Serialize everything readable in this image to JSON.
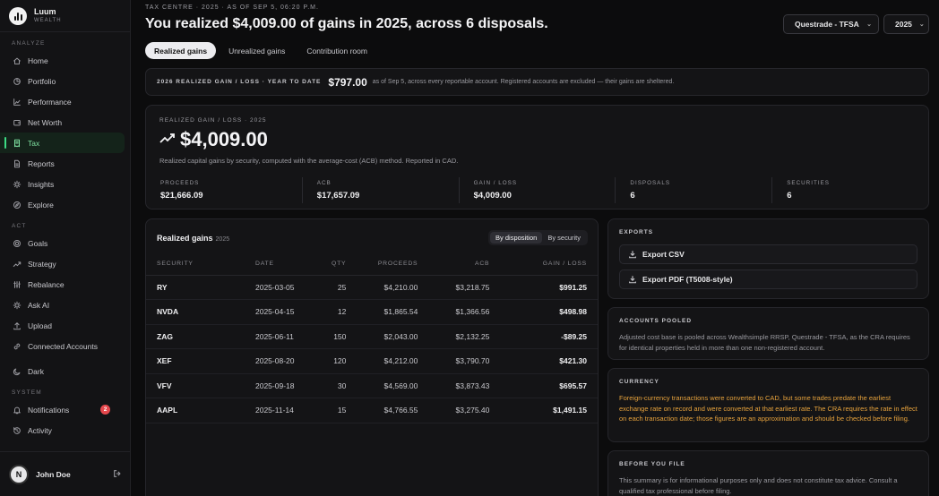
{
  "brand": {
    "name": "Luum",
    "sub": "WEALTH"
  },
  "sidebar": {
    "sections": [
      {
        "title": "ANALYZE",
        "items": [
          {
            "label": "Home",
            "icon": "home-icon"
          },
          {
            "label": "Portfolio",
            "icon": "pie-chart-icon"
          },
          {
            "label": "Performance",
            "icon": "line-chart-icon"
          },
          {
            "label": "Net Worth",
            "icon": "wallet-icon"
          },
          {
            "label": "Tax",
            "icon": "receipt-icon",
            "active": true
          },
          {
            "label": "Reports",
            "icon": "document-icon"
          },
          {
            "label": "Insights",
            "icon": "sparkle-icon"
          },
          {
            "label": "Explore",
            "icon": "compass-icon"
          }
        ]
      },
      {
        "title": "ACT",
        "items": [
          {
            "label": "Goals",
            "icon": "target-icon"
          },
          {
            "label": "Strategy",
            "icon": "trend-icon"
          },
          {
            "label": "Rebalance",
            "icon": "sliders-icon"
          },
          {
            "label": "Ask AI",
            "icon": "sparkle-icon"
          },
          {
            "label": "Upload",
            "icon": "upload-icon"
          },
          {
            "label": "Connected Accounts",
            "icon": "link-icon"
          },
          {
            "label": "Dark",
            "icon": "moon-icon"
          }
        ]
      },
      {
        "title": "SYSTEM",
        "items": [
          {
            "label": "Notifications",
            "icon": "bell-icon",
            "badge": "2"
          },
          {
            "label": "Activity",
            "icon": "history-icon"
          }
        ]
      }
    ]
  },
  "user": {
    "name": "John Doe",
    "initial": "N"
  },
  "header": {
    "eyebrow": "TAX CENTRE · 2025 · AS OF SEP 5, 06:20 P.M.",
    "headline": "You realized $4,009.00 of gains in 2025, across 6 disposals.",
    "account_select": "Questrade - TFSA",
    "year_select": "2025"
  },
  "tabs": [
    "Realized gains",
    "Unrealized gains",
    "Contribution room"
  ],
  "ytd": {
    "label": "2026 REALIZED GAIN / LOSS · YEAR TO DATE",
    "value": "$797.00",
    "note": "as of Sep 5, across every reportable account. Registered accounts are excluded — their gains are sheltered."
  },
  "summary": {
    "eyebrow": "REALIZED GAIN / LOSS · 2025",
    "value": "$4,009.00",
    "desc": "Realized capital gains by security, computed with the average-cost (ACB) method. Reported in CAD.",
    "stats": [
      {
        "label": "PROCEEDS",
        "value": "$21,666.09"
      },
      {
        "label": "ACB",
        "value": "$17,657.09"
      },
      {
        "label": "GAIN / LOSS",
        "value": "$4,009.00"
      },
      {
        "label": "DISPOSALS",
        "value": "6"
      },
      {
        "label": "SECURITIES",
        "value": "6"
      }
    ]
  },
  "gains": {
    "title": "Realized gains",
    "year": "2025",
    "seg": [
      "By disposition",
      "By security"
    ],
    "columns": [
      "SECURITY",
      "DATE",
      "QTY",
      "PROCEEDS",
      "ACB",
      "GAIN / LOSS"
    ],
    "rows": [
      [
        "RY",
        "2025-03-05",
        "25",
        "$4,210.00",
        "$3,218.75",
        "$991.25"
      ],
      [
        "NVDA",
        "2025-04-15",
        "12",
        "$1,865.54",
        "$1,366.56",
        "$498.98"
      ],
      [
        "ZAG",
        "2025-06-11",
        "150",
        "$2,043.00",
        "$2,132.25",
        "-$89.25"
      ],
      [
        "XEF",
        "2025-08-20",
        "120",
        "$4,212.00",
        "$3,790.70",
        "$421.30"
      ],
      [
        "VFV",
        "2025-09-18",
        "30",
        "$4,569.00",
        "$3,873.43",
        "$695.57"
      ],
      [
        "AAPL",
        "2025-11-14",
        "15",
        "$4,766.55",
        "$3,275.40",
        "$1,491.15"
      ]
    ]
  },
  "exports": {
    "title": "EXPORTS",
    "csv": "Export CSV",
    "pdf": "Export PDF (T5008-style)"
  },
  "pooled": {
    "title": "ACCOUNTS POOLED",
    "text": "Adjusted cost base is pooled across Wealthsimple RRSP, Questrade - TFSA, as the CRA requires for identical properties held in more than one non-registered account."
  },
  "currency": {
    "title": "CURRENCY",
    "text": "Foreign-currency transactions were converted to CAD, but some trades predate the earliest exchange rate on record and were converted at that earliest rate. The CRA requires the rate in effect on each transaction date; those figures are an approximation and should be checked before filing."
  },
  "before": {
    "title": "BEFORE YOU FILE",
    "text": "This summary is for informational purposes only and does not constitute tax advice. Consult a qualified tax professional before filing."
  }
}
